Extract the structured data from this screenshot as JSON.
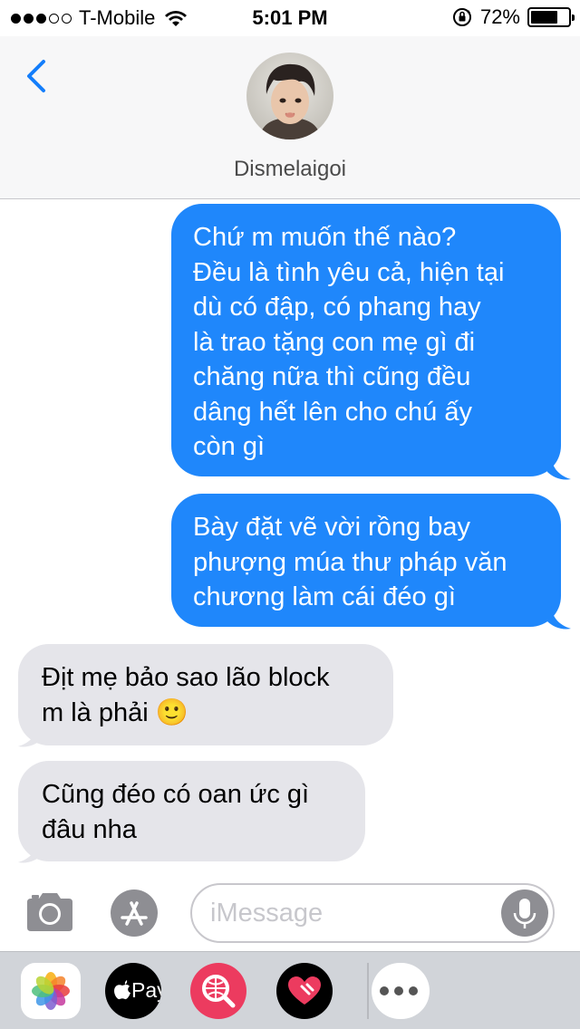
{
  "status_bar": {
    "carrier": "T-Mobile",
    "signal_bars_filled": 3,
    "signal_bars_total": 5,
    "time": "5:01 PM",
    "battery_percent_label": "72%",
    "battery_level": 0.72
  },
  "header": {
    "contact_name": "Dismelaigoi"
  },
  "messages": [
    {
      "direction": "sent",
      "lines": [
        "Chứ m muốn thế nào?",
        "Đều là tình yêu cả, hiện tại",
        "dù có đập, có phang hay",
        "là trao tặng con mẹ gì đi",
        "chăng nữa thì cũng đều",
        "dâng hết lên cho chú ấy",
        "còn gì"
      ]
    },
    {
      "direction": "sent",
      "lines": [
        "Bày đặt vẽ vời rồng bay",
        "phượng múa thư pháp văn",
        "chương làm cái đéo gì"
      ]
    },
    {
      "direction": "received",
      "lines": [
        "Địt mẹ bảo sao lão block",
        "m là phải 🙂"
      ]
    },
    {
      "direction": "received",
      "lines": [
        "Cũng đéo có oan ức gì",
        "đâu nha"
      ]
    }
  ],
  "input": {
    "placeholder": "iMessage",
    "value": ""
  },
  "app_drawer": {
    "items": [
      {
        "name": "photos-icon"
      },
      {
        "name": "apple-pay-icon",
        "label": "Pay"
      },
      {
        "name": "search-images-icon"
      },
      {
        "name": "digital-touch-icon"
      }
    ],
    "more": "more-icon"
  },
  "colors": {
    "sent_bubble": "#1f87fb",
    "received_bubble": "#e5e5ea",
    "ios_blue": "#147efb",
    "header_bg": "#f7f7f8",
    "drawer_bg": "#d1d4d9"
  }
}
